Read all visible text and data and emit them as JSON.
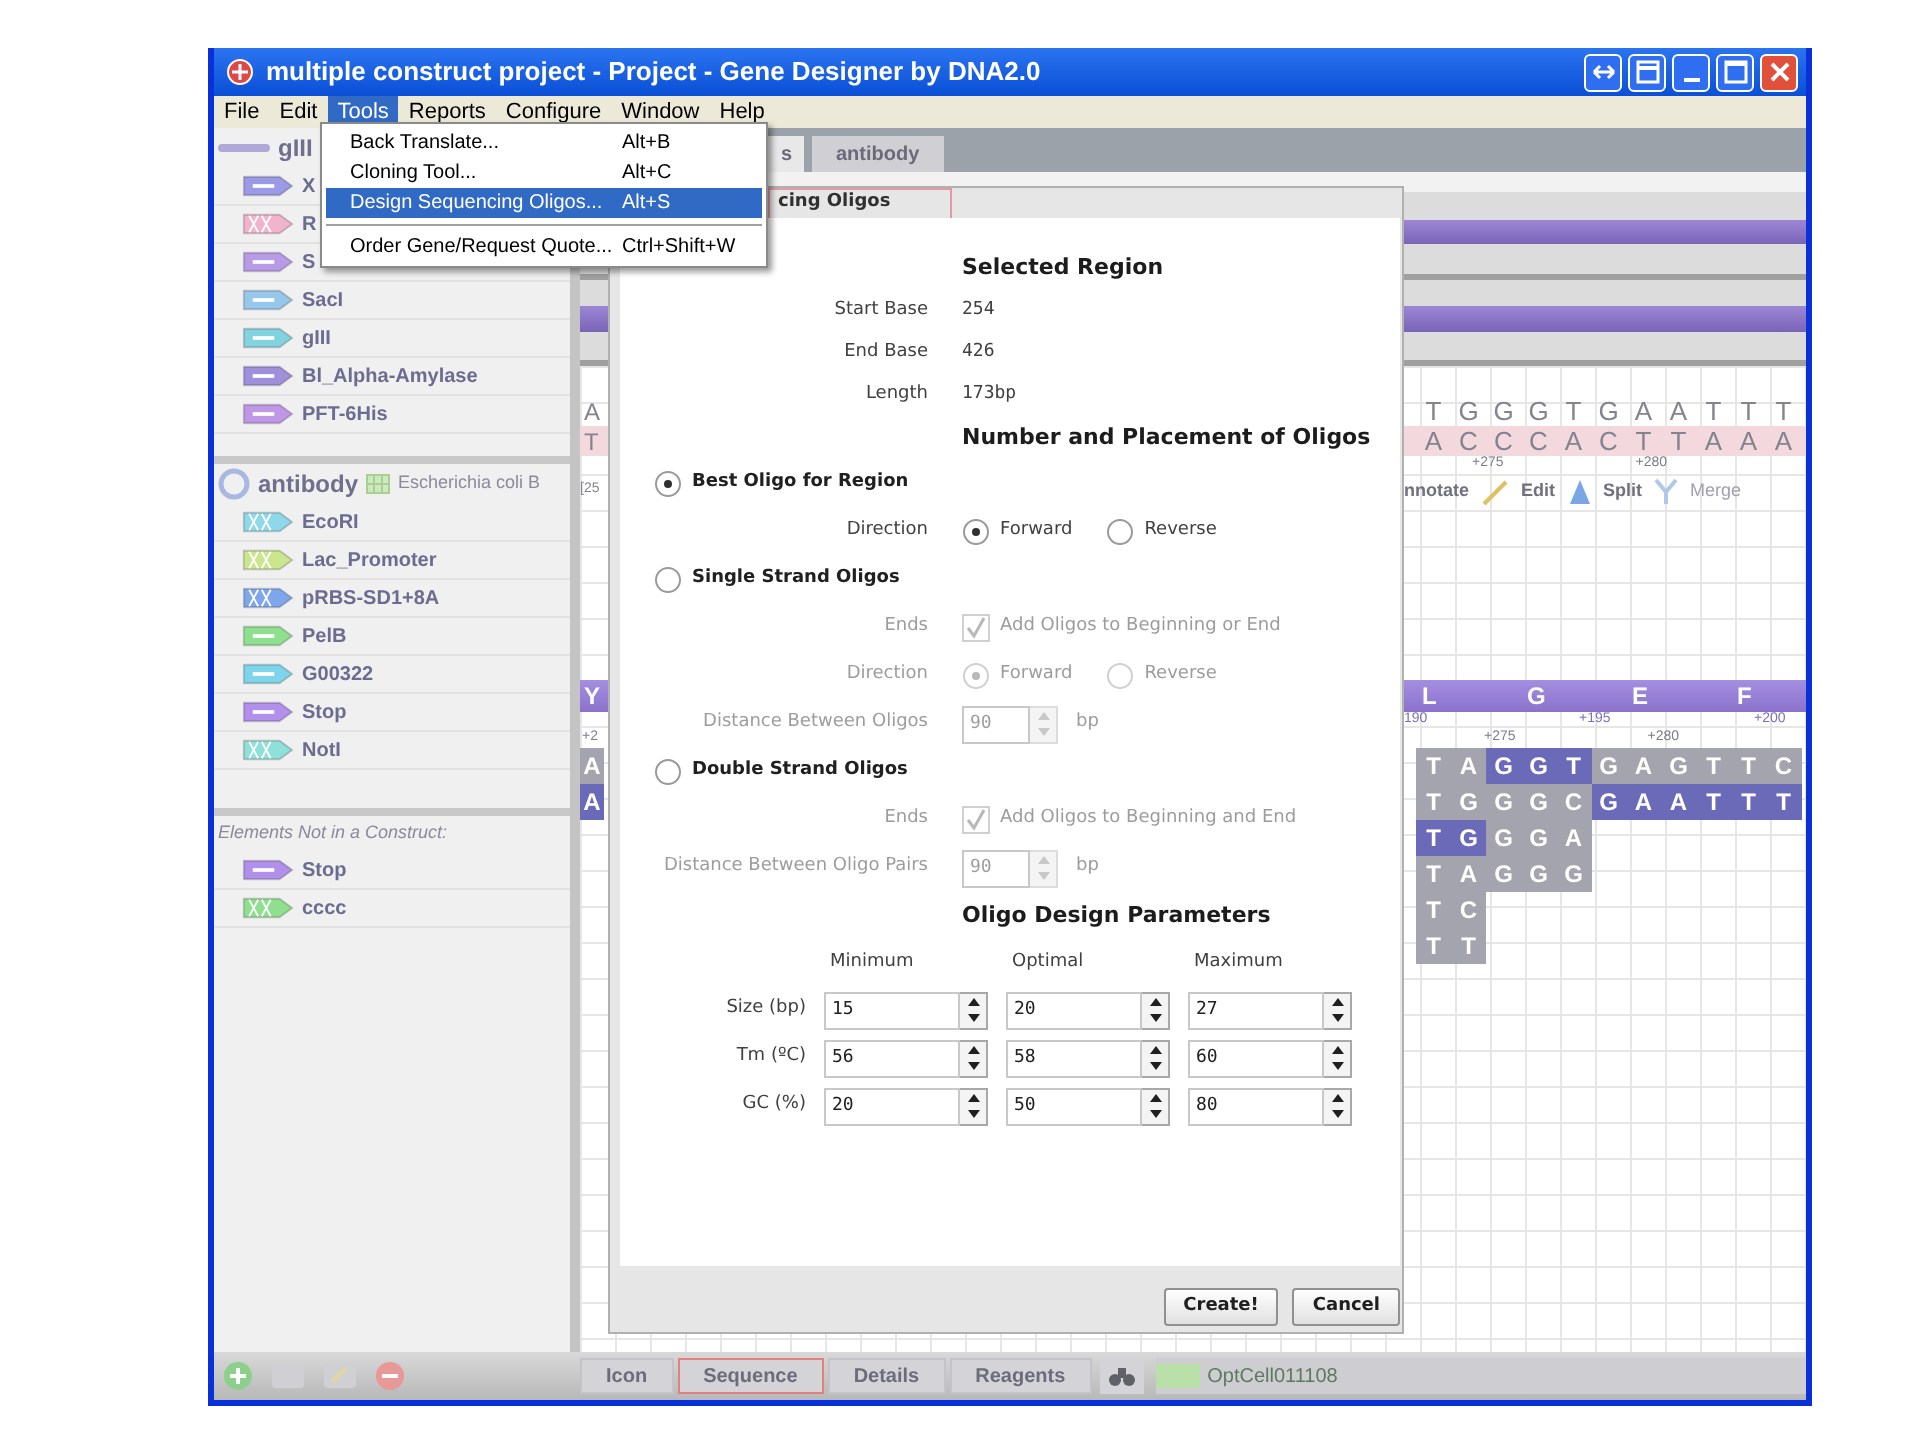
{
  "window": {
    "title": "multiple construct project - Project - Gene Designer by DNA2.0"
  },
  "menu_bar": [
    {
      "label": "File",
      "selected": false
    },
    {
      "label": "Edit",
      "selected": false
    },
    {
      "label": "Tools",
      "selected": true
    },
    {
      "label": "Reports",
      "selected": false
    },
    {
      "label": "Configure",
      "selected": false
    },
    {
      "label": "Window",
      "selected": false
    },
    {
      "label": "Help",
      "selected": false
    }
  ],
  "tools_menu": [
    {
      "kind": "item",
      "label": "Back Translate...",
      "shortcut": "Alt+B",
      "selected": false
    },
    {
      "kind": "item",
      "label": "Cloning Tool...",
      "shortcut": "Alt+C",
      "selected": false
    },
    {
      "kind": "item",
      "label": "Design Sequencing Oligos...",
      "shortcut": "Alt+S",
      "selected": true
    },
    {
      "kind": "separator"
    },
    {
      "kind": "item",
      "label": "Order Gene/Request Quote...",
      "shortcut": "Ctrl+Shift+W",
      "selected": false
    }
  ],
  "sidebar": {
    "constructs": [
      {
        "name": "gIII",
        "kind": "linear",
        "elements": [
          {
            "kind": "gene",
            "label": "X",
            "color": "#9a9ae6"
          },
          {
            "kind": "site",
            "label": "R",
            "color": "#f2b4cc"
          },
          {
            "kind": "gene",
            "label": "S",
            "color": "#b89ae6"
          },
          {
            "kind": "gene",
            "label": "SacI",
            "color": "#96c8ec"
          },
          {
            "kind": "gene",
            "label": "gIII",
            "color": "#82d2e0"
          },
          {
            "kind": "gene",
            "label": "Bl_Alpha-Amylase",
            "color": "#a090dc"
          },
          {
            "kind": "gene",
            "label": "PFT-6His",
            "color": "#c096e6"
          }
        ]
      },
      {
        "name": "antibody",
        "kind": "circular",
        "organism": "Escherichia coli B",
        "elements": [
          {
            "kind": "site",
            "label": "EcoRI",
            "color": "#8ed8ea"
          },
          {
            "kind": "site",
            "label": "Lac_Promoter",
            "color": "#cce68e"
          },
          {
            "kind": "site",
            "label": "pRBS-SD1+8A",
            "color": "#7ea6ea"
          },
          {
            "kind": "gene",
            "label": "PelB",
            "color": "#8ee08e"
          },
          {
            "kind": "gene",
            "label": "G00322",
            "color": "#7ed4ea"
          },
          {
            "kind": "gene",
            "label": "Stop",
            "color": "#b090ea"
          },
          {
            "kind": "site",
            "label": "NotI",
            "color": "#8ee0d8"
          }
        ]
      }
    ],
    "loose_heading": "Elements Not in a Construct:",
    "loose_elements": [
      {
        "kind": "gene",
        "label": "Stop",
        "color": "#b090ea"
      },
      {
        "kind": "site",
        "label": "cccc",
        "color": "#8ee08e"
      }
    ]
  },
  "main_tabs": [
    {
      "label": "s",
      "selected": true
    },
    {
      "label": "antibody",
      "selected": false
    }
  ],
  "sequence_view": {
    "top_strand": {
      "left": "A",
      "bases": [
        "T",
        "G",
        "G",
        "G",
        "T",
        "G",
        "A",
        "A",
        "T",
        "T",
        "T"
      ]
    },
    "bottom_strand": {
      "left": "T",
      "bases": [
        "A",
        "C",
        "C",
        "C",
        "A",
        "C",
        "T",
        "T",
        "A",
        "A",
        "A"
      ]
    },
    "strand_positions": [
      "+275",
      "+280"
    ],
    "range_label": "[25",
    "tools": [
      {
        "kind": "annotate",
        "label": "nnotate",
        "disabled": false
      },
      {
        "kind": "edit",
        "label": "Edit",
        "disabled": false
      },
      {
        "kind": "split",
        "label": "Split",
        "disabled": false
      },
      {
        "kind": "merge",
        "label": "Merge",
        "disabled": true
      }
    ],
    "translation": {
      "left": "Y",
      "residues": [
        "L",
        "G",
        "E",
        "F"
      ]
    },
    "aa_positions": [
      "190",
      "+195",
      "+200"
    ],
    "nt_positions_left": "+2",
    "nt_positions": [
      "+275",
      "+280"
    ],
    "oligo_rows": [
      {
        "left": "A",
        "left_highlighted": false,
        "cells": [
          {
            "base": "T",
            "highlighted": false
          },
          {
            "base": "A",
            "highlighted": false
          },
          {
            "base": "G",
            "highlighted": true
          },
          {
            "base": "G",
            "highlighted": true
          },
          {
            "base": "T",
            "highlighted": true
          },
          {
            "base": "G",
            "highlighted": false
          },
          {
            "base": "A",
            "highlighted": false
          },
          {
            "base": "G",
            "highlighted": false
          },
          {
            "base": "T",
            "highlighted": false
          },
          {
            "base": "T",
            "highlighted": false
          },
          {
            "base": "C",
            "highlighted": false
          }
        ]
      },
      {
        "left": "A",
        "left_highlighted": true,
        "cells": [
          {
            "base": "T",
            "highlighted": false
          },
          {
            "base": "G",
            "highlighted": false
          },
          {
            "base": "G",
            "highlighted": false
          },
          {
            "base": "G",
            "highlighted": false
          },
          {
            "base": "C",
            "highlighted": false
          },
          {
            "base": "G",
            "highlighted": true
          },
          {
            "base": "A",
            "highlighted": true
          },
          {
            "base": "A",
            "highlighted": true
          },
          {
            "base": "T",
            "highlighted": true
          },
          {
            "base": "T",
            "highlighted": true
          },
          {
            "base": "T",
            "highlighted": true
          }
        ]
      },
      {
        "cells": [
          {
            "base": "T",
            "highlighted": true
          },
          {
            "base": "G",
            "highlighted": true
          },
          {
            "base": "G",
            "highlighted": false
          },
          {
            "base": "G",
            "highlighted": false
          },
          {
            "base": "A",
            "highlighted": false
          }
        ]
      },
      {
        "cells": [
          {
            "base": "T",
            "highlighted": false
          },
          {
            "base": "A",
            "highlighted": false
          },
          {
            "base": "G",
            "highlighted": false
          },
          {
            "base": "G",
            "highlighted": false
          },
          {
            "base": "G",
            "highlighted": false
          }
        ]
      },
      {
        "cells": [
          {
            "base": "T",
            "highlighted": false
          },
          {
            "base": "C",
            "highlighted": false
          }
        ]
      },
      {
        "cells": [
          {
            "base": "T",
            "highlighted": false
          },
          {
            "base": "T",
            "highlighted": false
          }
        ]
      }
    ]
  },
  "dialog": {
    "tab_label": "cing Oligos",
    "selected_region": {
      "heading": "Selected Region",
      "fields": [
        {
          "label": "Start Base",
          "value": "254"
        },
        {
          "label": "End Base",
          "value": "426"
        },
        {
          "label": "Length",
          "value": "173bp"
        }
      ]
    },
    "placement": {
      "heading": "Number and Placement of Oligos",
      "options": [
        {
          "label": "Best Oligo for Region",
          "selected": true,
          "rows": [
            {
              "kind": "radio",
              "label": "Direction",
              "disabled": false,
              "choices": [
                {
                  "label": "Forward",
                  "selected": true
                },
                {
                  "label": "Reverse",
                  "selected": false
                }
              ]
            }
          ]
        },
        {
          "label": "Single Strand Oligos",
          "selected": false,
          "rows": [
            {
              "kind": "checkbox",
              "label": "Ends",
              "disabled": true,
              "checked": true,
              "text": "Add Oligos to Beginning or End"
            },
            {
              "kind": "radio",
              "label": "Direction",
              "disabled": true,
              "choices": [
                {
                  "label": "Forward",
                  "selected": true
                },
                {
                  "label": "Reverse",
                  "selected": false
                }
              ]
            },
            {
              "kind": "spinner",
              "label": "Distance Between Oligos",
              "disabled": true,
              "value": "90",
              "unit": "bp"
            }
          ]
        },
        {
          "label": "Double Strand Oligos",
          "selected": false,
          "rows": [
            {
              "kind": "checkbox",
              "label": "Ends",
              "disabled": true,
              "checked": true,
              "text": "Add Oligos to Beginning and End"
            },
            {
              "kind": "spinner",
              "label": "Distance Between Oligo Pairs",
              "disabled": true,
              "value": "90",
              "unit": "bp"
            }
          ]
        }
      ]
    },
    "parameters": {
      "heading": "Oligo Design Parameters",
      "columns": [
        "Minimum",
        "Optimal",
        "Maximum"
      ],
      "rows": [
        {
          "label": "Size (bp)",
          "values": [
            "15",
            "20",
            "27"
          ]
        },
        {
          "label": "Tm (ºC)",
          "values": [
            "56",
            "58",
            "60"
          ]
        },
        {
          "label": "GC (%)",
          "values": [
            "20",
            "50",
            "80"
          ]
        }
      ]
    },
    "buttons": [
      "Create!",
      "Cancel"
    ]
  },
  "view_tabs": [
    {
      "label": "Icon",
      "selected": false
    },
    {
      "label": "Sequence",
      "selected": true
    },
    {
      "label": "Details",
      "selected": false
    },
    {
      "label": "Reagents",
      "selected": false
    }
  ],
  "codon_table": "OptCell011108"
}
